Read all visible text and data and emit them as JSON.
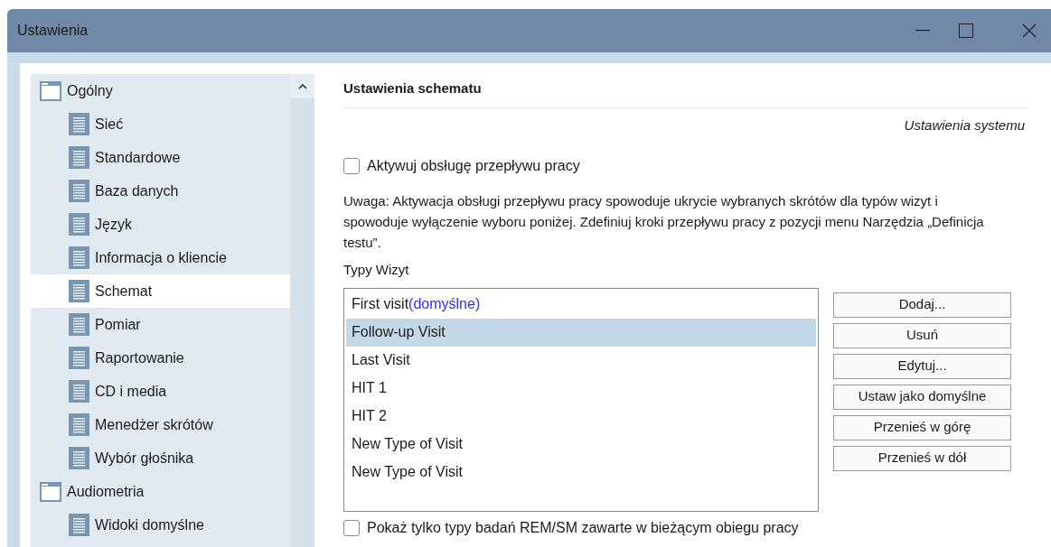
{
  "window": {
    "title": "Ustawienia"
  },
  "sidebar": {
    "items": [
      {
        "label": "Ogólny",
        "kind": "folder",
        "selected": false,
        "children": [
          {
            "label": "Sieć",
            "kind": "page",
            "selected": false
          },
          {
            "label": "Standardowe",
            "kind": "page",
            "selected": false
          },
          {
            "label": "Baza danych",
            "kind": "page",
            "selected": false
          },
          {
            "label": "Język",
            "kind": "page",
            "selected": false
          },
          {
            "label": "Informacja o kliencie",
            "kind": "page",
            "selected": false
          },
          {
            "label": "Schemat",
            "kind": "page",
            "selected": true
          },
          {
            "label": "Pomiar",
            "kind": "page",
            "selected": false
          },
          {
            "label": "Raportowanie",
            "kind": "page",
            "selected": false
          },
          {
            "label": "CD i media",
            "kind": "page",
            "selected": false
          },
          {
            "label": "Menedżer skrótów",
            "kind": "page",
            "selected": false
          },
          {
            "label": "Wybór głośnika",
            "kind": "page",
            "selected": false
          }
        ]
      },
      {
        "label": "Audiometria",
        "kind": "folder",
        "selected": false,
        "children": [
          {
            "label": "Widoki domyślne",
            "kind": "page",
            "selected": false
          }
        ]
      }
    ]
  },
  "content": {
    "heading": "Ustawienia schematu",
    "link": "Ustawienia systemu",
    "workflow_checkbox": {
      "label": "Aktywuj obsługę przepływu pracy",
      "checked": false
    },
    "note": "Uwaga: Aktywacja obsługi przepływu pracy spowoduje ukrycie wybranych skrótów dla typów wizyt i spowoduje wyłączenie wyboru poniżej. Zdefiniuj kroki przepływu pracy z pozycji menu Narzędzia „Definicja testu”.",
    "visit_types_label": "Typy Wizyt",
    "visit_types": [
      {
        "label": "First visit",
        "suffix": "(domyślne)",
        "selected": false
      },
      {
        "label": "Follow-up Visit",
        "selected": true
      },
      {
        "label": "Last Visit",
        "selected": false
      },
      {
        "label": "HIT 1",
        "selected": false
      },
      {
        "label": "HIT 2",
        "selected": false
      },
      {
        "label": "New Type of Visit",
        "selected": false
      },
      {
        "label": "New Type of Visit",
        "selected": false
      }
    ],
    "buttons": [
      "Dodaj...",
      "Usuń",
      "Edytuj...",
      "Ustaw jako domyślne",
      "Przenieś w górę",
      "Przenieś w dół"
    ],
    "rem_checkbox": {
      "label": "Pokaż tylko typy badań REM/SM zawarte w bieżącym obiegu pracy",
      "checked": false
    }
  }
}
